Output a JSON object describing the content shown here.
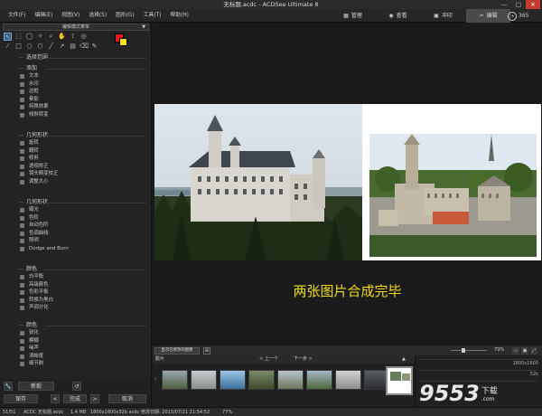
{
  "window": {
    "title": "无标题.acdc - ACDSee Ultimate 8",
    "min": "—",
    "max": "□",
    "close": "✕"
  },
  "menu": [
    "文件(F)",
    "编辑(E)",
    "视图(V)",
    "选择(S)",
    "图形(G)",
    "工具(T)",
    "帮助(H)"
  ],
  "modes": [
    {
      "label": "管理",
      "icon": "grid-icon",
      "active": false
    },
    {
      "label": "查看",
      "icon": "eye-icon",
      "active": false
    },
    {
      "label": "冲印",
      "icon": "develop-icon",
      "active": false
    },
    {
      "label": "编辑",
      "icon": "edit-tools-icon",
      "active": true
    }
  ],
  "mode365": "365",
  "left": {
    "dropdown": "编辑模式菜单",
    "sections": [
      {
        "title": "选择范围",
        "items": []
      },
      {
        "title": "添加",
        "items": [
          "文本",
          "水印",
          "边框",
          "晕影",
          "特殊效果",
          "倾斜转变"
        ]
      },
      {
        "title": "几何形状",
        "items": [
          "旋转",
          "翻转",
          "修剪",
          "透视修正",
          "镜头畸变校正",
          "调整大小"
        ]
      },
      {
        "title": "几何形状",
        "items": [
          "曝光",
          "色阶",
          "自动色阶",
          "色调曲线",
          "照明",
          "Dodge and Burn"
        ]
      },
      {
        "title": "颜色",
        "items": [
          "白平衡",
          "高级颜色",
          "色彩平衡",
          "转换为黑白",
          "声调分化"
        ]
      },
      {
        "title": "颜色",
        "items": [
          "锐化",
          "模糊",
          "噪声",
          "清晰度",
          "细节刷"
        ]
      }
    ],
    "buttons": {
      "new": "新毅",
      "save": "保存",
      "done": "完成",
      "cancel": "取消",
      "prev": "<",
      "next": ">"
    }
  },
  "viewer": {
    "caption": "两张图片合成完毕"
  },
  "filmbar": {
    "batch": "显示已修改的图像",
    "zoom": "79%",
    "left_label": "胶片",
    "prev": "< 上一个",
    "next": "下一步 >"
  },
  "info": {
    "dims": "1800x1600",
    "size": "52k"
  },
  "status": {
    "count": "51/51",
    "type": "ACDC",
    "file": "无标题.acdc",
    "filesize": "1.4 MB",
    "dims": "1800x1600x32b acdc",
    "date": "修改日期: 2015/07/21 21:54:52",
    "zoom": "77%"
  },
  "watermark": {
    "brand": "9553",
    "suffix": "下载",
    "sub": ".com"
  }
}
